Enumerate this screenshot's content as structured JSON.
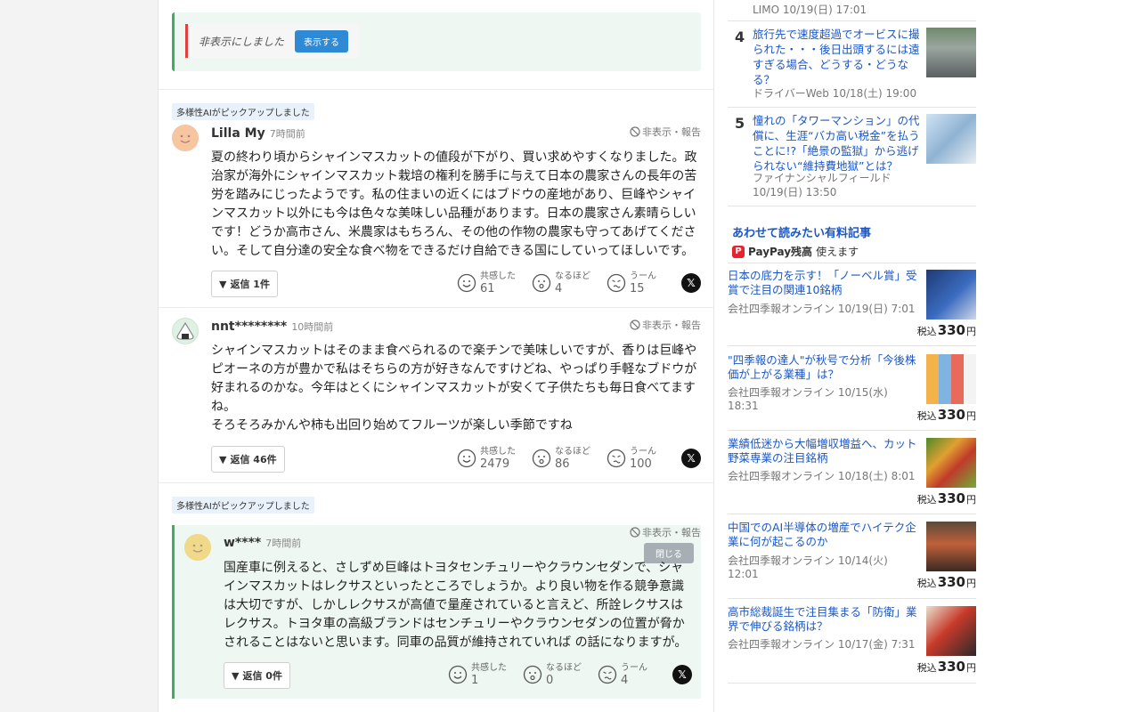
{
  "hidden_notice": {
    "text": "非表示にしました",
    "button": "表示する"
  },
  "comments": [
    {
      "pick": "多様性AIがピックアップしました",
      "user": "Lilla My",
      "time": "7時間前",
      "report": "非表示・報告",
      "body": "夏の終わり頃からシャインマスカットの値段が下がり、買い求めやすくなりました。政治家が海外にシャインマスカット栽培の権利を勝手に与えて日本の農家さんの長年の苦労を踏みにじったようです。私の住まいの近くにはブドウの産地があり、巨峰やシャインマスカット以外にも今は色々な美味しい品種があります。日本の農家さん素晴らしいです！どうか高市さん、米農家はもちろん、その他の作物の農家も守ってあげてください。そして自分達の安全な食べ物をできるだけ自給できる国にしていってほしいです。",
      "reply": "返信 1件",
      "reactions": [
        {
          "label": "共感した",
          "count": "61"
        },
        {
          "label": "なるほど",
          "count": "4"
        },
        {
          "label": "うーん",
          "count": "15"
        }
      ]
    },
    {
      "user": "nnt********",
      "time": "10時間前",
      "report": "非表示・報告",
      "body": "シャインマスカットはそのまま食べられるので楽チンで美味しいですが、香りは巨峰やピオーネの方が豊かで私はそちらの方が好きなんですけどね、やっぱり手軽なブドウが好まれるのかな。今年はとくにシャインマスカットが安くて子供たちも毎日食べてますね。\nそろそろみかんや柿も出回り始めてフルーツが楽しい季節ですね",
      "reply": "返信 46件",
      "reactions": [
        {
          "label": "共感した",
          "count": "2479"
        },
        {
          "label": "なるほど",
          "count": "86"
        },
        {
          "label": "うーん",
          "count": "100"
        }
      ]
    },
    {
      "pick": "多様性AIがピックアップしました",
      "user": "w****",
      "time": "7時間前",
      "report": "非表示・報告",
      "close": "閉じる",
      "body": "国産車に例えると、さしずめ巨峰はトヨタセンチュリーやクラウンセダンで、シャインマスカットはレクサスといったところでしょうか。より良い物を作る競争意識は大切ですが、しかしレクサスが高値で量産されていると言えど、所詮レクサスはレクサス。トヨタ車の高級ブランドはセンチュリーやクラウンセダンの位置が脅かされることはないと思います。同車の品質が維持されていれば の話になりますが。",
      "reply": "返信 0件",
      "reactions": [
        {
          "label": "共感した",
          "count": "1"
        },
        {
          "label": "なるほど",
          "count": "0"
        },
        {
          "label": "うーん",
          "count": "4"
        }
      ]
    }
  ],
  "ranking": {
    "top_source": "LIMO 10/19(日) 17:01",
    "items": [
      {
        "rank": "4",
        "title": "旅行先で速度超過でオービスに撮られた・・・後日出頭するには遠すぎる場合、どうする・どうなる？",
        "source": "ドライバーWeb 10/18(土) 19:00"
      },
      {
        "rank": "5",
        "title": "憧れの「タワーマンション」の代償に、生涯“バカ高い税金”を払うことに!?「絶景の監獄」から逃げられない“維持費地獄”とは？",
        "source": "ファイナンシャルフィールド 10/19(日) 13:50"
      }
    ]
  },
  "paid": {
    "heading": "あわせて読みたい有料記事",
    "paypay_brand": "PayPay残高",
    "paypay_suffix": "使えます",
    "items": [
      {
        "title": "日本の底力を示す！「ノーベル賞」受賞で注目の関連10銘柄",
        "source": "会社四季報オンライン 10/19(日) 7:01",
        "price_pre": "税込",
        "price": "330",
        "yen": "円"
      },
      {
        "title": "\"四季報の達人\"が秋号で分析「今後株価が上がる業種」は？",
        "source": "会社四季報オンライン 10/15(水) 18:31",
        "price_pre": "税込",
        "price": "330",
        "yen": "円"
      },
      {
        "title": "業績低迷から大幅増収増益へ、カット野菜専業の注目銘柄",
        "source": "会社四季報オンライン 10/18(土) 8:01",
        "price_pre": "税込",
        "price": "330",
        "yen": "円"
      },
      {
        "title": "中国でのAI半導体の増産でハイテク企業に何が起こるのか",
        "source": "会社四季報オンライン 10/14(火) 12:01",
        "price_pre": "税込",
        "price": "330",
        "yen": "円"
      },
      {
        "title": "高市総裁誕生で注目集まる「防衛」業界で伸びる銘柄は？",
        "source": "会社四季報オンライン 10/17(金) 7:31",
        "price_pre": "税込",
        "price": "330",
        "yen": "円"
      }
    ]
  },
  "colors": {
    "link": "#1a57c9",
    "accent_green": "#3db060",
    "accent_red": "#e04040",
    "button_blue": "#2f8ad6"
  }
}
